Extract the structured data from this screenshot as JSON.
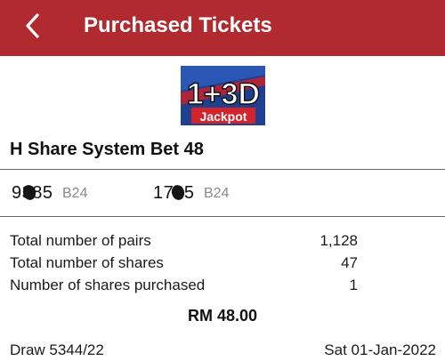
{
  "header": {
    "title": "Purchased Tickets",
    "back_icon": "chevron-left-icon",
    "background": "#b02a30"
  },
  "logo": {
    "main": "1+3D",
    "sub": "Jackpot"
  },
  "bet": {
    "title": "H Share System Bet 48",
    "numbers": [
      {
        "number": "9385",
        "type": "B24"
      },
      {
        "number": "1765",
        "type": "B24"
      }
    ]
  },
  "summary": [
    {
      "label": "Total number of pairs",
      "value": "1,128"
    },
    {
      "label": "Total number of shares",
      "value": "47"
    },
    {
      "label": "Number of shares purchased",
      "value": "1"
    }
  ],
  "amount": "RM 48.00",
  "footer": {
    "draw": "Draw 5344/22",
    "date": "Sat 01-Jan-2022"
  }
}
